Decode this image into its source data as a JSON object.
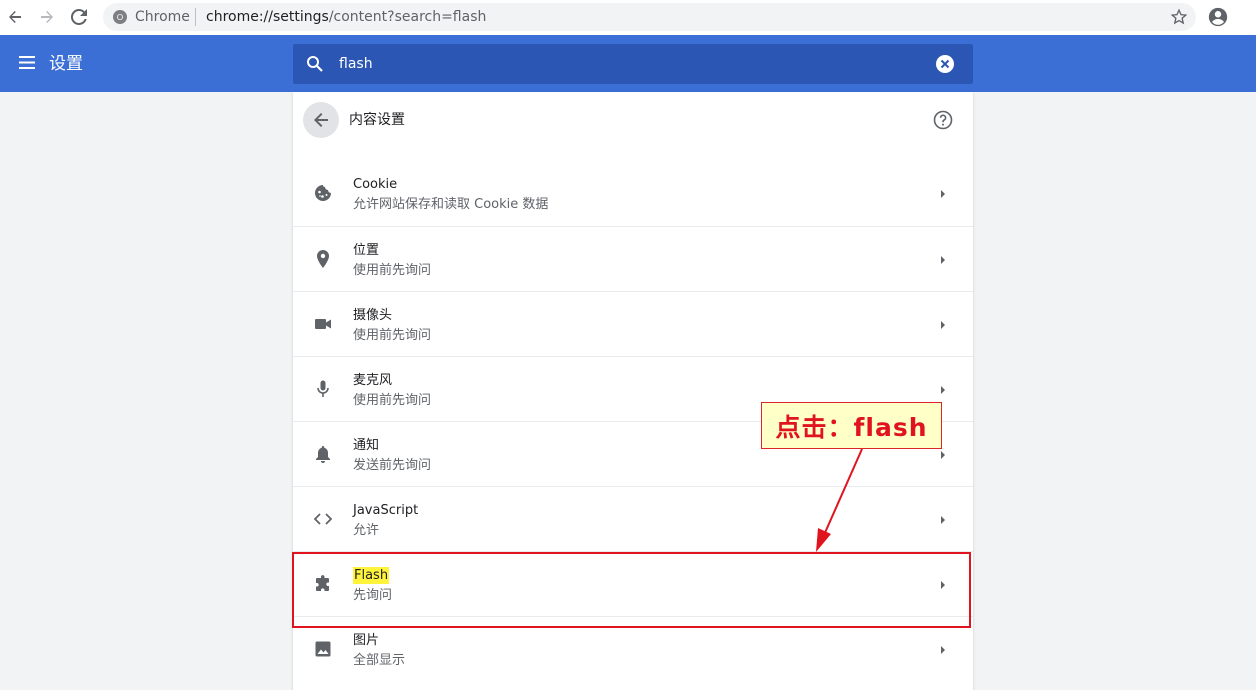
{
  "browser": {
    "omnibox_label": "Chrome",
    "url_host": "chrome://settings",
    "url_path": "/content?search=flash"
  },
  "header": {
    "title": "设置",
    "search_value": "flash"
  },
  "subpage": {
    "title": "内容设置"
  },
  "rows": [
    {
      "title": "Cookie",
      "subtitle": "允许网站保存和读取 Cookie 数据",
      "icon": "cookie-icon"
    },
    {
      "title": "位置",
      "subtitle": "使用前先询问",
      "icon": "location-icon"
    },
    {
      "title": "摄像头",
      "subtitle": "使用前先询问",
      "icon": "camera-icon"
    },
    {
      "title": "麦克风",
      "subtitle": "使用前先询问",
      "icon": "microphone-icon"
    },
    {
      "title": "通知",
      "subtitle": "发送前先询问",
      "icon": "bell-icon"
    },
    {
      "title": "JavaScript",
      "subtitle": "允许",
      "icon": "code-icon"
    },
    {
      "title": "Flash",
      "subtitle": "先询问",
      "icon": "puzzle-icon",
      "highlighted": true
    },
    {
      "title": "图片",
      "subtitle": "全部显示",
      "icon": "image-icon"
    }
  ],
  "annotation": {
    "callout_text": "点击：flash"
  },
  "colors": {
    "header_bg": "#3b6fd6",
    "search_bg": "#2c56b3",
    "highlight": "#fff33b",
    "annotation_red": "#e0141e",
    "callout_bg": "#ffffc8"
  }
}
